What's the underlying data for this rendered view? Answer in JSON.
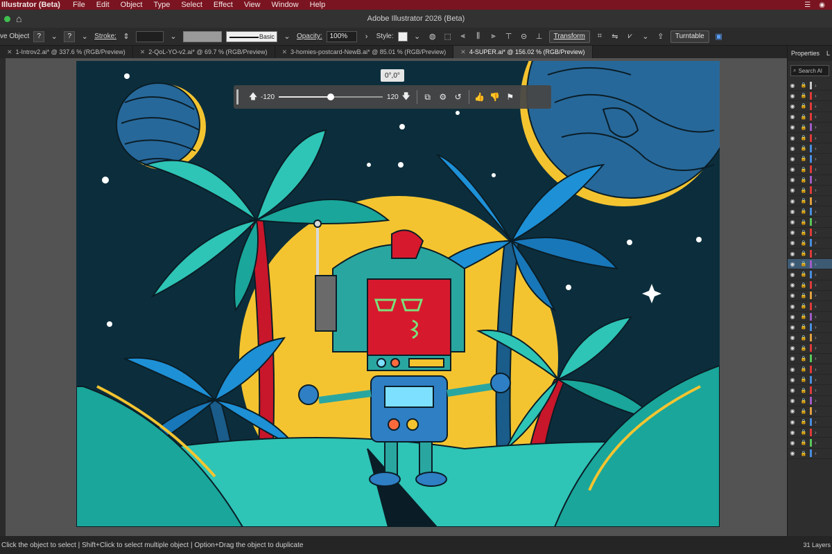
{
  "menubar": {
    "app_name": "Illustrator (Beta)",
    "items": [
      "File",
      "Edit",
      "Object",
      "Type",
      "Select",
      "Effect",
      "View",
      "Window",
      "Help"
    ]
  },
  "titlebar": {
    "title": "Adobe Illustrator 2026 (Beta)"
  },
  "control_bar": {
    "object_label": "ve Object",
    "stroke_label": "Stroke:",
    "stroke_style": "Basic",
    "opacity_label": "Opacity:",
    "opacity_value": "100%",
    "style_label": "Style:",
    "transform_label": "Transform",
    "turntable_label": "Turntable"
  },
  "tabs": [
    {
      "label": "1-Introv2.ai* @ 337.6 % (RGB/Preview)",
      "active": false
    },
    {
      "label": "2-QoL-YO-v2.ai* @ 69.7 % (RGB/Preview)",
      "active": false
    },
    {
      "label": "3-homies-postcard-NewB.ai* @ 85.01 % (RGB/Preview)",
      "active": false
    },
    {
      "label": "4-SUPER.ai* @ 156.02 % (RGB/Preview)",
      "active": true
    }
  ],
  "context_bar": {
    "min_value": "-120",
    "max_value": "120",
    "slider_value": 0,
    "slider_min": -120,
    "slider_max": 120
  },
  "angle_tooltip": "0°,0°",
  "right_panel": {
    "tabs": [
      "Properties",
      "L"
    ],
    "search_placeholder": "Search Al",
    "layer_colors": [
      "#c9c9c9",
      "#e03a3a",
      "#e03a3a",
      "#e03a3a",
      "#a05cc8",
      "#e03a3a",
      "#4a8ee0",
      "#4a8ee0",
      "#e03a3a",
      "#a05cc8",
      "#e03a3a",
      "#e0a040",
      "#4a8ee0",
      "#5ac85a",
      "#e03a3a",
      "#4a8ee0",
      "#e03a3a",
      "#a05cc8",
      "#4a8ee0",
      "#e03a3a",
      "#e0a040",
      "#e03a3a",
      "#a05cc8",
      "#4a8ee0",
      "#e0a040",
      "#e03a3a",
      "#5ac85a",
      "#e03a3a",
      "#4a8ee0",
      "#e03a3a",
      "#a05cc8",
      "#e0a040",
      "#4a8ee0",
      "#e03a3a",
      "#5ac85a",
      "#4a8ee0"
    ],
    "selected_row": 17
  },
  "statusbar": {
    "hint": "Click the object to select  |  Shift+Click to select multiple object  |  Option+Drag the object to duplicate",
    "layer_count": "31 Layers"
  },
  "colors": {
    "menubar_bg": "#7a1420",
    "artboard_bg": "#0c2e3c",
    "moon_yellow": "#f4c430",
    "palm_teal": "#2ec4b6",
    "palm_blue": "#1e90d6",
    "robot_red": "#d7192d"
  }
}
